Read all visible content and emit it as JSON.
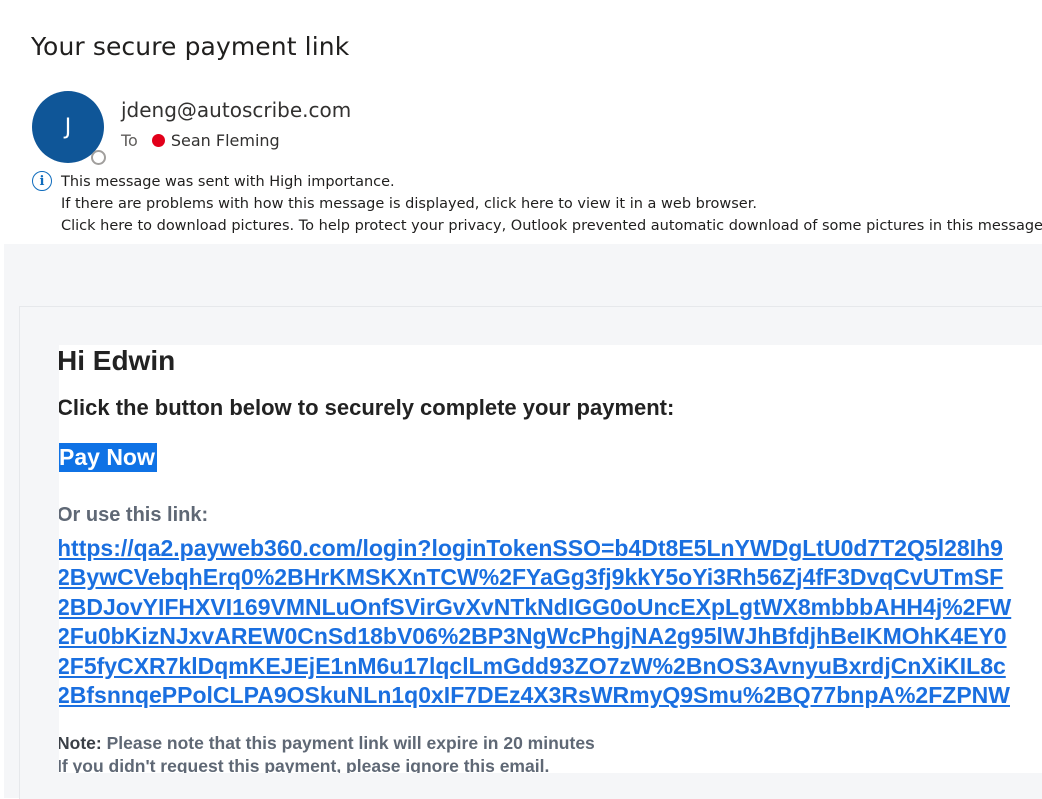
{
  "email": {
    "subject": "Your secure payment link",
    "avatar_initial": "J",
    "sender": "jdeng@autoscribe.com",
    "to_label": "To",
    "recipient": "Sean Fleming",
    "info": {
      "line1": "This message was sent with High importance.",
      "line2": "If there are problems with how this message is displayed, click here to view it in a web browser.",
      "line3": "Click here to download pictures. To help protect your privacy, Outlook prevented automatic download of some pictures in this message."
    }
  },
  "body": {
    "greeting": "Hi Edwin",
    "instruction": "Click the button below to securely complete your payment:",
    "pay_button": "Pay Now",
    "or_use_link": "Or use this link:",
    "link_lines": [
      "https://qa2.payweb360.com/login?loginTokenSSO=b4Dt8E5LnYWDgLtU0d7T2Q5l28Ih9",
      "2BywCVebqhErq0%2BHrKMSKXnTCW%2FYaGg3fj9kkY5oYi3Rh56Zj4fF3DvqCvUTmSF",
      "2BDJovYIFHXVI169VMNLuOnfSVirGvXvNTkNdIGG0oUncEXpLgtWX8mbbbAHH4j%2FW",
      "2Fu0bKizNJxvAREW0CnSd18bV06%2BP3NgWcPhgjNA2g95lWJhBfdjhBeIKMOhK4EY0",
      "2F5fyCXR7klDqmKEJEjE1nM6u17lqclLmGdd93ZO7zW%2BnOS3AvnyuBxrdjCnXiKIL8c",
      "2BfsnnqePPolCLPA9OSkuNLn1q0xIF7DEz4X3RsWRmyQ9Smu%2BQ77bnpA%2FZPNW"
    ],
    "note_label": "Note:",
    "note_text": " Please note that this payment link will expire in 20 minutes",
    "ignore_text": "If you didn't request this payment, please ignore this email."
  },
  "colors": {
    "avatar": "#0f5698",
    "button": "#0f72e5",
    "link": "#1a6fe0",
    "recipient_status": "#e2001a"
  },
  "icons": {
    "info": "info-icon",
    "presence": "presence-status-icon",
    "recipient_status": "status-dot-icon"
  }
}
